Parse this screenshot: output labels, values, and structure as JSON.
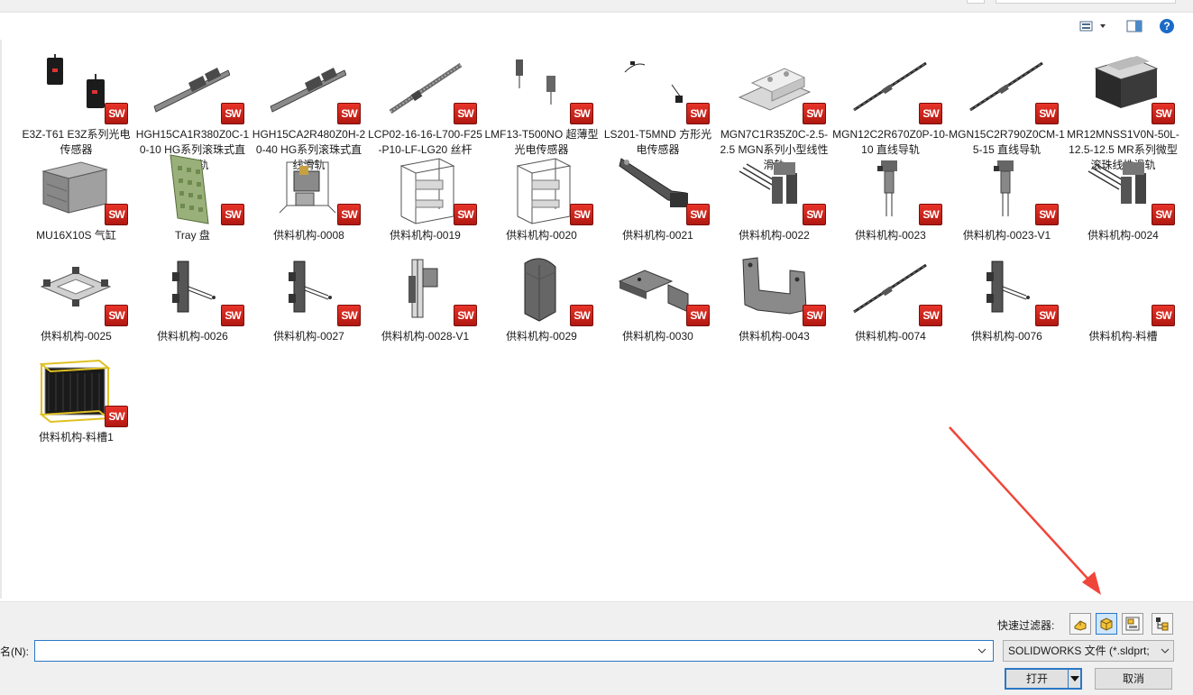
{
  "colors": {
    "accent": "#2b78c5",
    "sw_badge": "#d42a20",
    "annotation_arrow": "#f0453a"
  },
  "toolbar": {
    "view_menu_icon": "view-options-icon",
    "preview_icon": "preview-pane-icon",
    "help_icon": "help-icon",
    "help_glyph": "?"
  },
  "files": [
    {
      "label": "E3Z-T61 E3Z系列光电传感器",
      "thumb": "sensor-pair"
    },
    {
      "label": "HGH15CA1R380Z0C-10-10 HG系列滚珠式直线滑轨",
      "thumb": "rail"
    },
    {
      "label": "HGH15CA2R480Z0H-20-40 HG系列滚珠式直线滑轨",
      "thumb": "rail"
    },
    {
      "label": "LCP02-16-16-L700-F25-P10-LF-LG20 丝杆",
      "thumb": "screw"
    },
    {
      "label": "LMF13-T500NO 超薄型光电传感器",
      "thumb": "sensor-pair-small"
    },
    {
      "label": "LS201-T5MND 方形光电传感器",
      "thumb": "wire-sensor"
    },
    {
      "label": "MGN7C1R35Z0C-2.5-2.5 MGN系列小型线性滑轨",
      "thumb": "mini-rail"
    },
    {
      "label": "MGN12C2R670Z0P-10-10 直线导轨",
      "thumb": "thin-rail"
    },
    {
      "label": "MGN15C2R790Z0CM-15-15 直线导轨",
      "thumb": "thin-rail"
    },
    {
      "label": "MR12MNSS1V0N-50L-12.5-12.5 MR系列微型滚珠线性滑轨",
      "thumb": "block"
    },
    {
      "label": "MU16X10S 气缸",
      "thumb": "cylinder"
    },
    {
      "label": "Tray 盘",
      "thumb": "tray"
    },
    {
      "label": "供料机构-0008",
      "thumb": "assembly"
    },
    {
      "label": "供料机构-0019",
      "thumb": "frame"
    },
    {
      "label": "供料机构-0020",
      "thumb": "frame"
    },
    {
      "label": "供料机构-0021",
      "thumb": "arm"
    },
    {
      "label": "供料机构-0022",
      "thumb": "gripper"
    },
    {
      "label": "供料机构-0023",
      "thumb": "small-mech"
    },
    {
      "label": "供料机构-0023-V1",
      "thumb": "small-mech"
    },
    {
      "label": "供料机构-0024",
      "thumb": "gripper"
    },
    {
      "label": "供料机构-0025",
      "thumb": "plate-assembly"
    },
    {
      "label": "供料机构-0026",
      "thumb": "clamp"
    },
    {
      "label": "供料机构-0027",
      "thumb": "clamp"
    },
    {
      "label": "供料机构-0028-V1",
      "thumb": "column"
    },
    {
      "label": "供料机构-0029",
      "thumb": "shield"
    },
    {
      "label": "供料机构-0030",
      "thumb": "bracket"
    },
    {
      "label": "供料机构-0043",
      "thumb": "u-bracket"
    },
    {
      "label": "供料机构-0074",
      "thumb": "thin-rail"
    },
    {
      "label": "供料机构-0076",
      "thumb": "clamp"
    },
    {
      "label": "供料机构-料槽",
      "thumb": "none"
    },
    {
      "label": "供料机构-料槽1",
      "thumb": "cage"
    }
  ],
  "sw_badge_text": "SW",
  "bottom": {
    "quick_filter_label": "快速过滤器:",
    "quick_filters": [
      {
        "icon": "filter-parts-icon",
        "active": false
      },
      {
        "icon": "filter-assemblies-icon",
        "active": true
      },
      {
        "icon": "filter-drawings-icon",
        "active": false
      },
      {
        "icon": "filter-top-level-assemblies-icon",
        "active": false
      }
    ],
    "filename_label": "名(N):",
    "filename_value": "",
    "file_type": "SOLIDWORKS 文件 (*.sldprt;",
    "open_label": "打开",
    "cancel_label": "取消"
  }
}
